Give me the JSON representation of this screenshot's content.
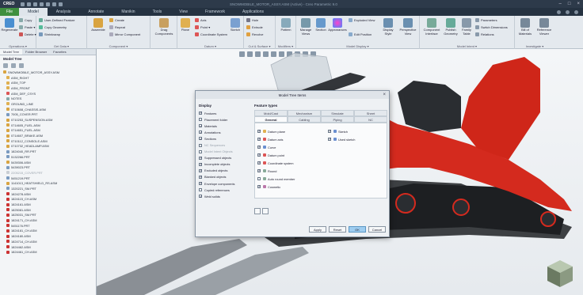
{
  "app": {
    "logo": "CREO",
    "window_title": "SNOWMOBILE_MOTOR_ASSY.ASM (Active) - Creo Parametric 9.0",
    "colors": {
      "accent_green": "#3f8f3f",
      "ribbon_bg": "#e4e9ee",
      "titlebar_bg": "#2d3a4a",
      "model_red": "#d42a1e",
      "ok_blue": "#9ecdf0"
    }
  },
  "menu": {
    "file_label": "File",
    "tabs": [
      "Model",
      "Analysis",
      "Annotate",
      "Manikin",
      "Tools",
      "View",
      "Framework",
      "Applications"
    ]
  },
  "ribbon": {
    "groups": {
      "operations": "Operations ▾",
      "get_data": "Get Data ▾",
      "component": "Component ▾",
      "datum": "Datum ▾",
      "cut_surface": "Cut & Surface ▾",
      "modifiers": "Modifiers ▾",
      "model_display": "Model Display ▾",
      "model_intent": "Model Intent ▾",
      "investigate": "Investigate ▾"
    },
    "buttons": {
      "regenerate": "Regenerate",
      "copy": "Copy",
      "paste": "Paste ▾",
      "delete": "Delete ▾",
      "user_defined_feature": "User-Defined Feature",
      "copy_geometry": "Copy Geometry",
      "shrinkwrap": "Shrinkwrap",
      "assemble": "Assemble",
      "create": "Create",
      "repeat": "Repeat",
      "mirror_component": "Mirror Component",
      "drag_components": "Drag Components",
      "plane": "Plane",
      "axis": "Axis",
      "point": "Point ▾",
      "coordinate_system": "Coordinate System",
      "sketch": "Sketch",
      "hole": "Hole",
      "extrude": "Extrude",
      "revolve": "Revolve",
      "pattern": "Pattern",
      "manage_views": "Manage Views",
      "section": "Section",
      "appearances": "Appearances",
      "exploded_view": "Exploded View",
      "edit_position": "Edit Position",
      "display_style": "Display Style",
      "perspective_view": "Perspective View",
      "component_interface": "Component Interface",
      "publish_geometry": "Publish Geometry",
      "family_table": "Family Table",
      "parameters": "Parameters",
      "switch_dimensions": "Switch Dimensions",
      "relations": "Relations",
      "bill_of_materials": "Bill of Materials",
      "reference_viewer": "Reference Viewer"
    }
  },
  "left_panel": {
    "tabs": [
      "Model Tree",
      "Folder Browser",
      "Favorites"
    ],
    "title": "Model Tree",
    "tree": [
      {
        "label": "SNOWMOBILE_MOTOR_ASSY.ASM",
        "kind": "root"
      },
      {
        "label": "ASM_RIGHT",
        "kind": "datum"
      },
      {
        "label": "ASM_TOP",
        "kind": "datum"
      },
      {
        "label": "ASM_FRONT",
        "kind": "datum"
      },
      {
        "label": "ASM_DEF_CSYS",
        "kind": "csys"
      },
      {
        "label": "NOTES",
        "kind": "note"
      },
      {
        "label": "GROUND_LINE",
        "kind": "datum"
      },
      {
        "label": "0710608_CHASSIS.ASM",
        "kind": "asm"
      },
      {
        "label": "7005_COVER.PRT",
        "kind": "part"
      },
      {
        "label": "0710253_SUSPENSION.ASM",
        "kind": "asm"
      },
      {
        "label": "0714605_FUEL.ASM",
        "kind": "asm"
      },
      {
        "label": "0714651_FUEL.ASM",
        "kind": "asm"
      },
      {
        "label": "0714607_BRAKE.ASM",
        "kind": "asm"
      },
      {
        "label": "0710112_CONSOLE.ASM",
        "kind": "asm"
      },
      {
        "label": "0710732_HEADLAMP.ASM",
        "kind": "asm"
      },
      {
        "label": "1824040_RR.PRT",
        "kind": "part"
      },
      {
        "label": "5132266.PRT",
        "kind": "part"
      },
      {
        "label": "5439306.ASM",
        "kind": "asm"
      },
      {
        "label": "5439023.PRT",
        "kind": "part"
      },
      {
        "label": "2205215_COVER.PRT",
        "kind": "muted"
      },
      {
        "label": "5451219.PRT",
        "kind": "part"
      },
      {
        "label": "1141013_HEATSHIELD_RS.ASM",
        "kind": "asm"
      },
      {
        "label": "1320221_SM.PRT",
        "kind": "part"
      },
      {
        "label": "1824278.ASM",
        "kind": "red"
      },
      {
        "label": "1824115_CH.ASM",
        "kind": "red"
      },
      {
        "label": "1824161.ASM",
        "kind": "red"
      },
      {
        "label": "1825081.ASM",
        "kind": "red"
      },
      {
        "label": "1825031_SM.PRT",
        "kind": "red"
      },
      {
        "label": "1824171_CH.ASM",
        "kind": "red"
      },
      {
        "label": "5451176.PRT",
        "kind": "red"
      },
      {
        "label": "1824181_CH.ASM",
        "kind": "red"
      },
      {
        "label": "1824180.ASM",
        "kind": "red"
      },
      {
        "label": "1824714_CH.ASM",
        "kind": "red"
      },
      {
        "label": "1824462.ASM",
        "kind": "red"
      },
      {
        "label": "1824461_CH.ASM",
        "kind": "red"
      }
    ]
  },
  "dialog": {
    "title": "Model Tree Items",
    "display_heading": "Display",
    "display_items": [
      {
        "label": "Features",
        "checked": true
      },
      {
        "label": "Placement folder",
        "checked": false
      },
      {
        "label": "Materials",
        "checked": true
      },
      {
        "label": "Annotations",
        "checked": true
      },
      {
        "label": "Sections",
        "checked": true
      },
      {
        "label": "NC Sequences",
        "checked": false,
        "muted": true
      },
      {
        "label": "Model Intent Objects",
        "checked": false,
        "muted": true
      },
      {
        "label": "Suppressed objects",
        "checked": true
      },
      {
        "label": "Incomplete objects",
        "checked": true
      },
      {
        "label": "Excluded objects",
        "checked": true
      },
      {
        "label": "Blanked objects",
        "checked": true
      },
      {
        "label": "Envelope components",
        "checked": true
      },
      {
        "label": "Copied references",
        "checked": false
      },
      {
        "label": "Weld solids",
        "checked": true
      }
    ],
    "feature_types_heading": "Feature types",
    "tabs_row1": [
      "Mold/Cast",
      "Mechanism",
      "Simulate",
      "Sheet"
    ],
    "tabs_row2": [
      "General",
      "Cabling",
      "Piping",
      "NC"
    ],
    "features_col1": [
      {
        "label": "Datum plane",
        "checked": true
      },
      {
        "label": "Datum axis",
        "checked": true
      },
      {
        "label": "Curve",
        "checked": true
      },
      {
        "label": "Datum point",
        "checked": true
      },
      {
        "label": "Coordinate system",
        "checked": true
      },
      {
        "label": "Round",
        "checked": true
      },
      {
        "label": "Auto round member",
        "checked": false
      },
      {
        "label": "Cosmetic",
        "checked": true
      }
    ],
    "features_col2": [
      {
        "label": "Sketch",
        "checked": true
      },
      {
        "label": "Used sketch",
        "checked": true
      }
    ],
    "buttons": {
      "apply": "Apply",
      "reset": "Reset",
      "ok": "OK",
      "cancel": "Cancel"
    }
  }
}
